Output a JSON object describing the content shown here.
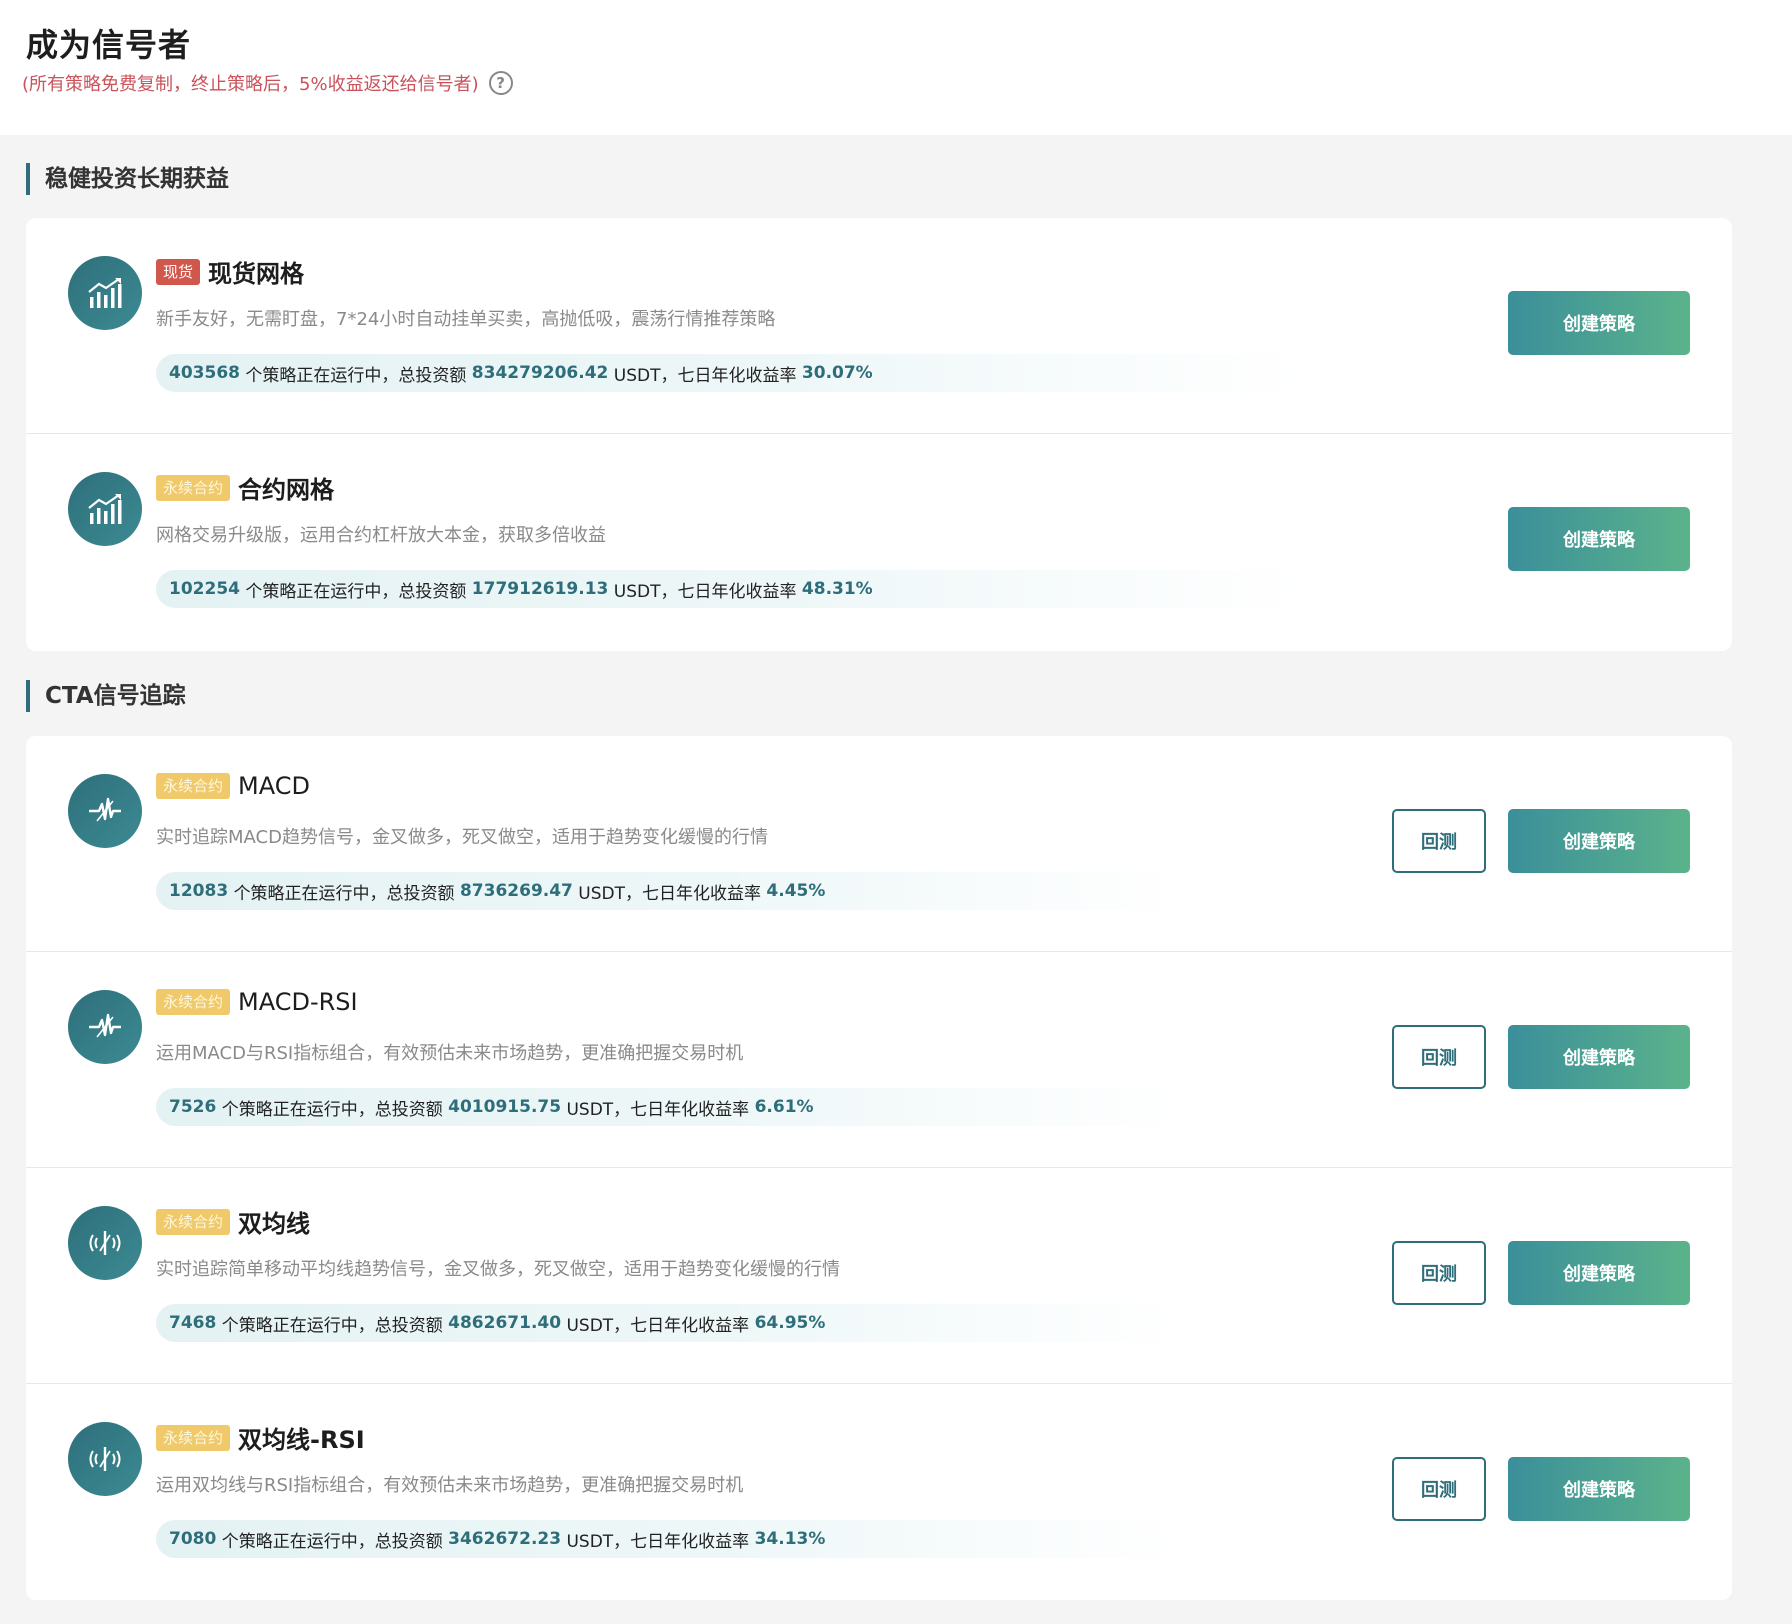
{
  "header": {
    "title": "成为信号者",
    "subtitle": "(所有策略免费复制，终止策略后，5%收益返还给信号者)",
    "help_glyph": "?"
  },
  "sections": [
    {
      "title": "稳健投资长期获益",
      "items": [
        {
          "tag": "现货",
          "name": "现货网格",
          "desc": "新手友好，无需盯盘，7*24小时自动挂单买卖，高抛低吸，震荡行情推荐策略",
          "running": "403568",
          "invest": "834279206.42",
          "rate": "30.07%",
          "create_label": "创建策略"
        },
        {
          "tag": "永续合约",
          "name": "合约网格",
          "desc": "网格交易升级版，运用合约杠杆放大本金，获取多倍收益",
          "running": "102254",
          "invest": "177912619.13",
          "rate": "48.31%",
          "create_label": "创建策略"
        }
      ]
    },
    {
      "title": "CTA信号追踪",
      "items": [
        {
          "tag": "永续合约",
          "name": "MACD",
          "desc": "实时追踪MACD趋势信号，金叉做多，死叉做空，适用于趋势变化缓慢的行情",
          "running": "12083",
          "invest": "8736269.47",
          "rate": "4.45%",
          "backtest_label": "回测",
          "create_label": "创建策略"
        },
        {
          "tag": "永续合约",
          "name": "MACD-RSI",
          "desc": "运用MACD与RSI指标组合，有效预估未来市场趋势，更准确把握交易时机",
          "running": "7526",
          "invest": "4010915.75",
          "rate": "6.61%",
          "backtest_label": "回测",
          "create_label": "创建策略"
        },
        {
          "tag": "永续合约",
          "name": "双均线",
          "desc": "实时追踪简单移动平均线趋势信号，金叉做多，死叉做空，适用于趋势变化缓慢的行情",
          "running": "7468",
          "invest": "4862671.40",
          "rate": "64.95%",
          "backtest_label": "回测",
          "create_label": "创建策略"
        },
        {
          "tag": "永续合约",
          "name": "双均线-RSI",
          "desc": "运用双均线与RSI指标组合，有效预估未来市场趋势，更准确把握交易时机",
          "running": "7080",
          "invest": "3462672.23",
          "rate": "34.13%",
          "backtest_label": "回测",
          "create_label": "创建策略"
        }
      ]
    }
  ],
  "labels": {
    "running_suffix": "个策略正在运行中，总投资额",
    "unit_text": "USDT，七日年化收益率"
  },
  "icons": [
    "bar-chart-icon",
    "bar-chart-icon",
    "pulse-icon",
    "pulse-icon",
    "signal-broadcast-icon",
    "signal-broadcast-icon"
  ],
  "colors": {
    "accent": "#2e6e7a",
    "spot_tag": "#d0574c",
    "perp_tag": "#efc96a",
    "subtitle": "#c9535b"
  }
}
